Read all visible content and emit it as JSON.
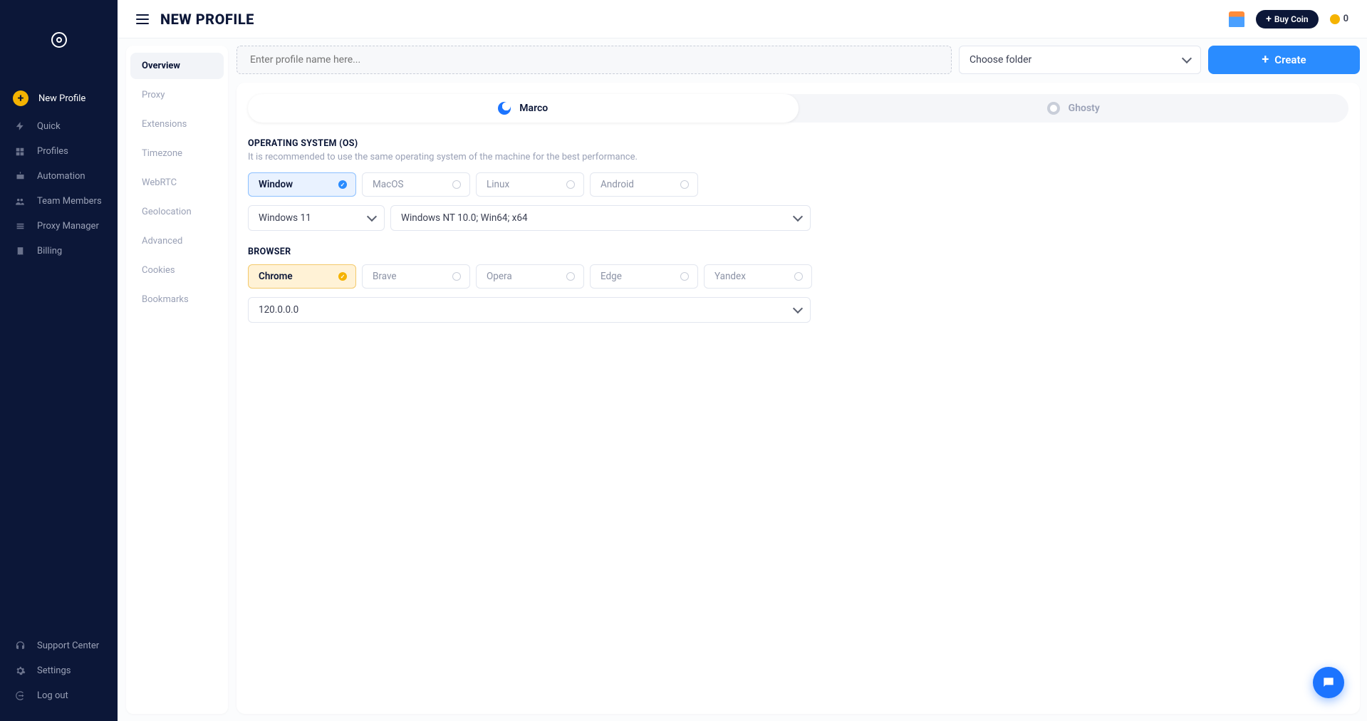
{
  "sidebar": {
    "items": [
      {
        "label": "New Profile",
        "icon": "plus-circle",
        "active": true
      },
      {
        "label": "Quick",
        "icon": "bolt"
      },
      {
        "label": "Profiles",
        "icon": "grid"
      },
      {
        "label": "Automation",
        "icon": "robot"
      },
      {
        "label": "Team Members",
        "icon": "people"
      },
      {
        "label": "Proxy Manager",
        "icon": "list"
      },
      {
        "label": "Billing",
        "icon": "receipt"
      }
    ],
    "footer": [
      {
        "label": "Support Center",
        "icon": "headset"
      },
      {
        "label": "Settings",
        "icon": "gear"
      },
      {
        "label": "Log out",
        "icon": "logout"
      }
    ]
  },
  "header": {
    "title": "NEW PROFILE",
    "buyCoin": "Buy Coin",
    "coinCount": "0"
  },
  "subnav": [
    "Overview",
    "Proxy",
    "Extensions",
    "Timezone",
    "WebRTC",
    "Geolocation",
    "Advanced",
    "Cookies",
    "Bookmarks"
  ],
  "subnavActive": 0,
  "form": {
    "namePlaceholder": "Enter profile name here...",
    "folderLabel": "Choose folder",
    "createLabel": "Create"
  },
  "core": {
    "tabs": [
      {
        "label": "Marco"
      },
      {
        "label": "Ghosty"
      }
    ],
    "active": 0
  },
  "os": {
    "title": "OPERATING SYSTEM (OS)",
    "hint": "It is recommended to use the same operating system of the machine for the best performance.",
    "options": [
      "Window",
      "MacOS",
      "Linux",
      "Android"
    ],
    "selected": 0,
    "version": "Windows 11",
    "ua": "Windows NT 10.0; Win64; x64"
  },
  "browser": {
    "title": "BROWSER",
    "options": [
      "Chrome",
      "Brave",
      "Opera",
      "Edge",
      "Yandex"
    ],
    "selected": 0,
    "version": "120.0.0.0"
  }
}
